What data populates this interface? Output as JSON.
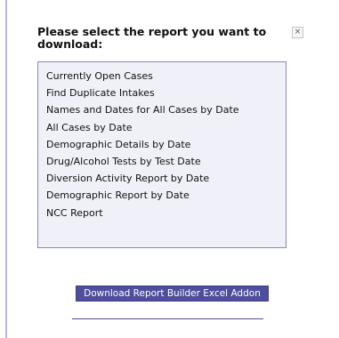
{
  "dialog": {
    "title": "Please select the report you want to download:",
    "close_label": "×"
  },
  "reports": [
    "Currently Open Cases",
    "Find Duplicate Intakes",
    "Names and Dates for All Cases by Date",
    "All Cases by Date",
    "Demographic Details by Date",
    "Drug/Alcohol Tests by Test Date",
    "Diversion Activity Report by Date",
    "Demographic Report by Date",
    "NCC Report"
  ],
  "actions": {
    "download_button_label": "Download Report Builder Excel Addon"
  },
  "colors": {
    "list_background": "#f0f0f8",
    "list_border": "#8a8ab4",
    "button_background": "#4e4e9c",
    "page_border": "#b8b8dc"
  }
}
